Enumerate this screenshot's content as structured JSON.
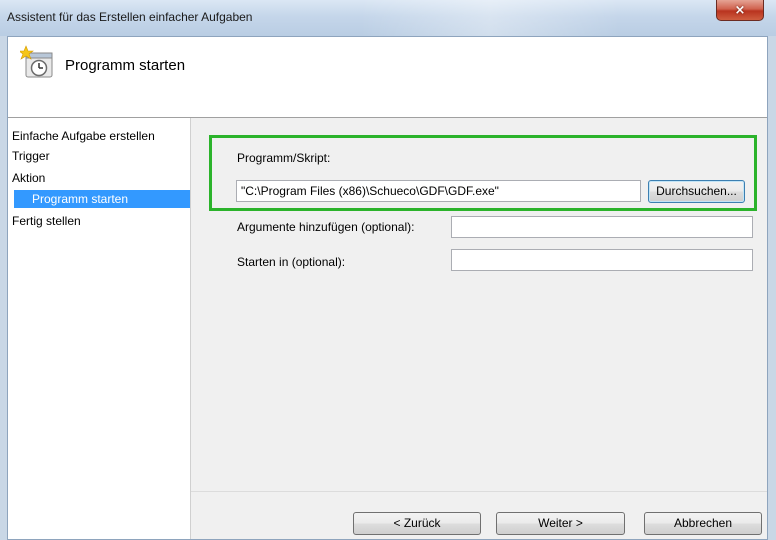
{
  "window": {
    "title": "Assistent für das Erstellen einfacher Aufgaben",
    "close_glyph": "×"
  },
  "header": {
    "icon": "scheduled-task-clock-icon",
    "title": "Programm starten"
  },
  "nav": {
    "items": [
      {
        "label": "Einfache Aufgabe erstellen",
        "selected": false
      },
      {
        "label": "Trigger",
        "selected": false
      },
      {
        "label": "Aktion",
        "selected": false
      },
      {
        "label": "Programm starten",
        "selected": true
      },
      {
        "label": "Fertig stellen",
        "selected": false
      }
    ]
  },
  "form": {
    "program_label": "Programm/Skript:",
    "program_value": "\"C:\\Program Files (x86)\\Schueco\\GDF\\GDF.exe\"",
    "browse_label": "Durchsuchen...",
    "arguments_label": "Argumente hinzufügen (optional):",
    "arguments_value": "",
    "start_in_label": "Starten in (optional):",
    "start_in_value": ""
  },
  "footer": {
    "back_label": "< Zurück",
    "next_label": "Weiter >",
    "cancel_label": "Abbrechen"
  },
  "colors": {
    "highlight": "#2bb32b",
    "selection": "#3399ff"
  }
}
